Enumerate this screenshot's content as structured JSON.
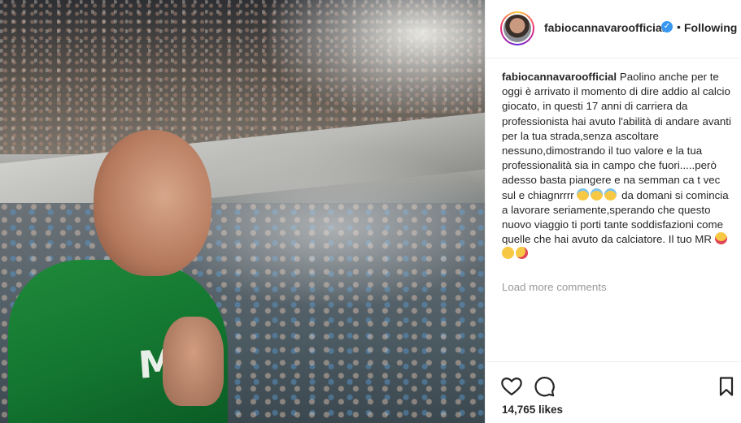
{
  "post": {
    "username": "fabiocannavaroofficial",
    "separator": "•",
    "follow_status": "Following",
    "verified_badge": "✓",
    "caption_text_1": "Paolino anche per te oggi è arrivato il momento di dire addio al calcio giocato, in questi 17 anni di carriera da professionista hai avuto l'abilità di andare avanti per la tua strada,senza ascoltare nessuno,dimostrando il tuo valore e la tua professionalità sia in campo che fuori.....però adesso basta piangere e na semman ca t vec sul e chiagnrrrr ",
    "caption_text_2": " da domani si comincia a lavorare seriamente,sperando che questo nuovo viaggio ti porti tante soddisfazioni come quelle che hai avuto da calciatore. Il tuo MR ",
    "load_more": "Load more comments",
    "likes": "14,765 likes",
    "photo_shirt_text": "MA"
  },
  "icons": {
    "verified": "verified-badge-icon",
    "like": "heart-icon",
    "comment": "comment-icon",
    "save": "bookmark-icon"
  },
  "colors": {
    "verified": "#3897f0",
    "muted": "#999999",
    "text": "#262626",
    "border": "#efefef"
  }
}
